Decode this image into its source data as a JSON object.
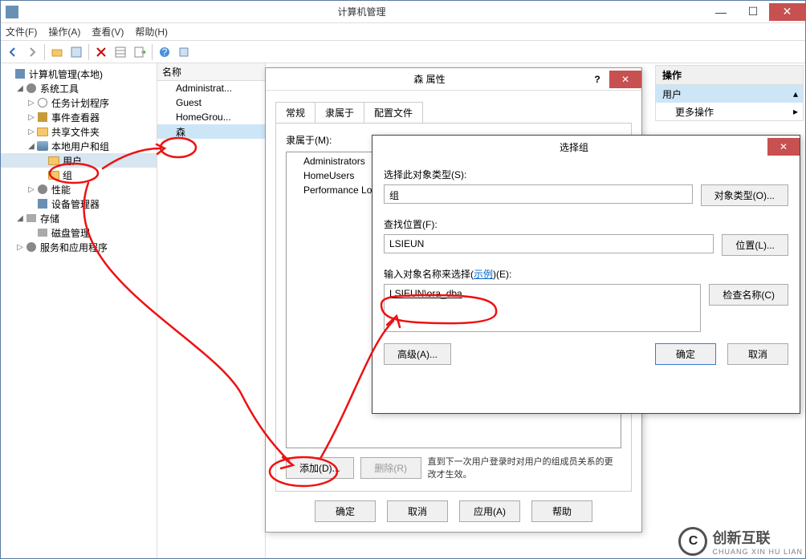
{
  "window": {
    "title": "计算机管理"
  },
  "menus": {
    "file": "文件(F)",
    "action": "操作(A)",
    "view": "查看(V)",
    "help": "帮助(H)"
  },
  "tree": {
    "root": "计算机管理(本地)",
    "system_tools": "系统工具",
    "task_scheduler": "任务计划程序",
    "event_viewer": "事件查看器",
    "shared_folders": "共享文件夹",
    "local_users_groups": "本地用户和组",
    "users": "用户",
    "groups": "组",
    "performance": "性能",
    "device_manager": "设备管理器",
    "storage": "存储",
    "disk_management": "磁盘管理",
    "services_apps": "服务和应用程序"
  },
  "list": {
    "header": "名称",
    "items": [
      "Administrat...",
      "Guest",
      "HomeGrou...",
      "森"
    ]
  },
  "actions": {
    "header": "操作",
    "sub": "用户",
    "more": "更多操作"
  },
  "props_dialog": {
    "title": "森 属性",
    "tabs": {
      "general": "常规",
      "memberof": "隶属于",
      "profile": "配置文件"
    },
    "memberof_label": "隶属于(M):",
    "members": [
      "Administrators",
      "HomeUsers",
      "Performance Log"
    ],
    "add": "添加(D)...",
    "remove": "删除(R)",
    "note": "直到下一次用户登录时对用户的组成员关系的更改才生效。",
    "ok": "确定",
    "cancel": "取消",
    "apply": "应用(A)",
    "help": "帮助"
  },
  "select_dialog": {
    "title": "选择组",
    "object_type_label": "选择此对象类型(S):",
    "object_type_value": "组",
    "object_type_btn": "对象类型(O)...",
    "location_label": "查找位置(F):",
    "location_value": "LSIEUN",
    "location_btn": "位置(L)...",
    "names_label_pre": "输入对象名称来选择(",
    "names_label_link": "示例",
    "names_label_post": ")(E):",
    "names_value": "LSIEUN\\ora_dba",
    "check_names": "检查名称(C)",
    "advanced": "高级(A)...",
    "ok": "确定",
    "cancel": "取消"
  },
  "watermark": {
    "brand": "创新互联",
    "sub": "CHUANG XIN HU LIAN"
  }
}
